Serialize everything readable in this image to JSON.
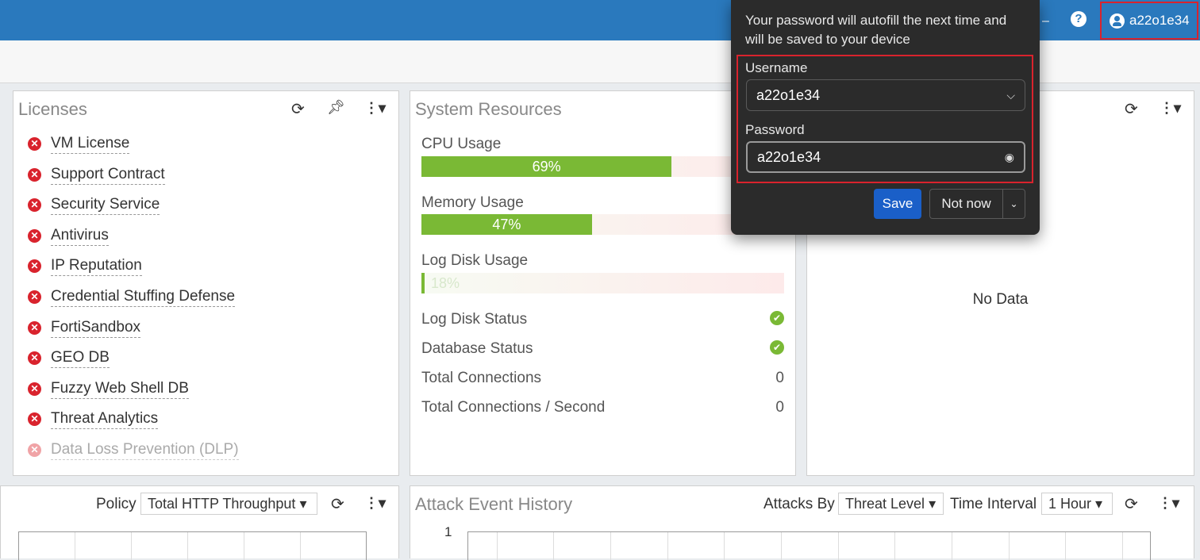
{
  "header": {
    "help_glyph": "?",
    "dash_glyph": "–",
    "username": "a22o1e34"
  },
  "licenses": {
    "title": "Licenses",
    "items": [
      {
        "label": "VM License",
        "status": "invalid"
      },
      {
        "label": "Support Contract",
        "status": "invalid"
      },
      {
        "label": "Security Service",
        "status": "invalid"
      },
      {
        "label": "Antivirus",
        "status": "invalid"
      },
      {
        "label": "IP Reputation",
        "status": "invalid"
      },
      {
        "label": "Credential Stuffing Defense",
        "status": "invalid"
      },
      {
        "label": "FortiSandbox",
        "status": "invalid"
      },
      {
        "label": "GEO DB",
        "status": "invalid"
      },
      {
        "label": "Fuzzy Web Shell DB",
        "status": "invalid"
      },
      {
        "label": "Threat Analytics",
        "status": "invalid"
      },
      {
        "label": "Data Loss Prevention (DLP)",
        "status": "disabled"
      }
    ]
  },
  "system_resources": {
    "title": "System Resources",
    "cpu_label": "CPU Usage",
    "cpu_percent": 69,
    "cpu_text": "69%",
    "memory_label": "Memory Usage",
    "memory_percent": 47,
    "memory_text": "47%",
    "logdisk_label": "Log Disk Usage",
    "logdisk_percent": 18,
    "logdisk_text": "18%",
    "log_disk_status_label": "Log Disk Status",
    "database_status_label": "Database Status",
    "total_connections_label": "Total Connections",
    "total_connections_value": "0",
    "total_cps_label": "Total Connections / Second",
    "total_cps_value": "0"
  },
  "right_panel": {
    "no_data": "No Data"
  },
  "throughput_panel": {
    "policy_label": "Policy",
    "policy_value": "Total HTTP Throughput"
  },
  "attack_panel": {
    "title": "Attack Event History",
    "attacks_by_label": "Attacks By",
    "attacks_by_value": "Threat Level",
    "time_interval_label": "Time Interval",
    "time_interval_value": "1 Hour",
    "y_tick": "1"
  },
  "password_popup": {
    "description": "Your password will autofill the next time and will be saved to your device",
    "username_label": "Username",
    "username_value": "a22o1e34",
    "password_label": "Password",
    "password_value": "a22o1e34",
    "save_label": "Save",
    "not_now_label": "Not now"
  },
  "colors": {
    "topbar": "#2a79bd",
    "progress": "#7ab935",
    "error": "#d9232d",
    "save_button": "#1a5fc8"
  }
}
